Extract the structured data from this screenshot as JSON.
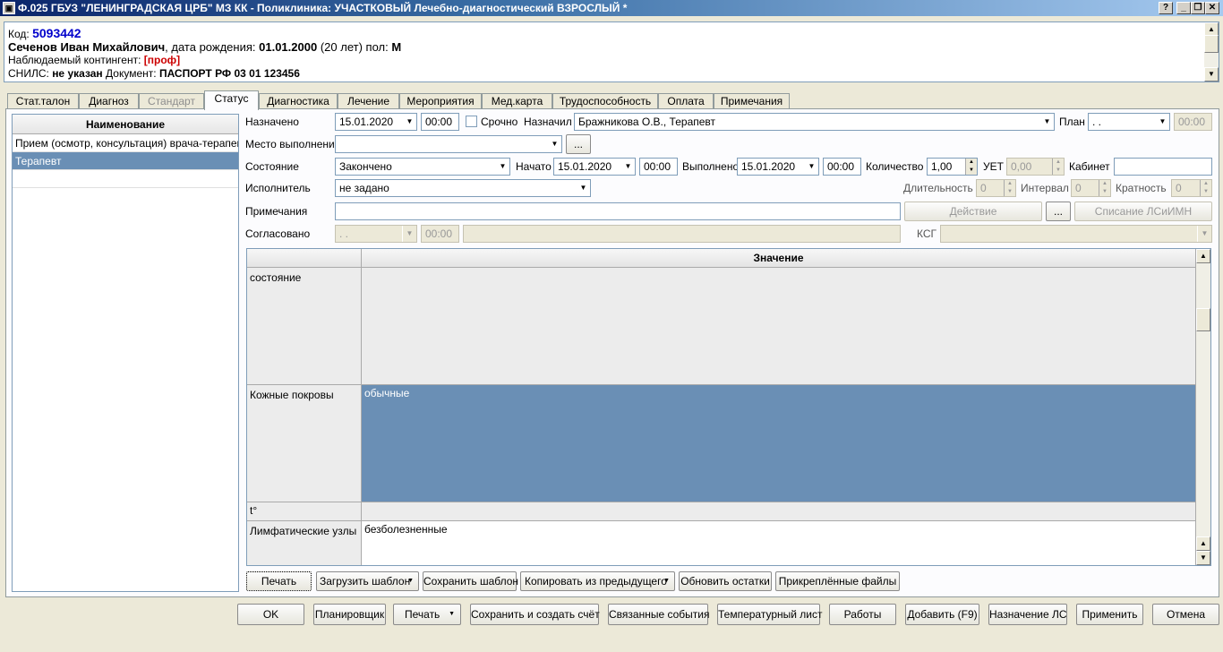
{
  "window": {
    "title": "Ф.025 ГБУЗ \"ЛЕНИНГРАДСКАЯ ЦРБ\" МЗ КК  - Поликлиника: УЧАСТКОВЫЙ Лечебно-диагностический ВЗРОСЛЫЙ *",
    "help_label": "?",
    "min_label": "_",
    "max_label": "❐",
    "close_label": "✕"
  },
  "patient": {
    "code_label": "Код:",
    "code": "5093442",
    "name": "Сеченов Иван Михайлович",
    "dob_label": ", дата рождения:",
    "dob": "01.01.2000",
    "age": "(20 лет)",
    "sex_label": "пол:",
    "sex": "М",
    "contingent_label": "Наблюдаемый контингент:",
    "contingent": "[проф]",
    "snils_label": "СНИЛС:",
    "snils": "не указан",
    "doc_label": "Документ:",
    "doc": "ПАСПОРТ РФ 03 01 123456"
  },
  "tabs": [
    {
      "label": "Стат.талон"
    },
    {
      "label": "Диагноз"
    },
    {
      "label": "Стандарт"
    },
    {
      "label": "Статус"
    },
    {
      "label": "Диагностика"
    },
    {
      "label": "Лечение"
    },
    {
      "label": "Мероприятия"
    },
    {
      "label": "Мед.карта"
    },
    {
      "label": "Трудоспособность"
    },
    {
      "label": "Оплата"
    },
    {
      "label": "Примечания"
    }
  ],
  "left_list": {
    "header": "Наименование",
    "rows": [
      "Прием (осмотр, консультация) врача-терапев...",
      "Терапевт"
    ]
  },
  "form": {
    "assigned_label": "Назначено",
    "assigned_date": "15.01.2020",
    "assigned_time": "00:00",
    "urgent_label": "Срочно",
    "assigned_by_label": "Назначил",
    "assigned_by": "Бражникова О.В., Терапевт",
    "plan_label": "План",
    "plan_value": " .  .",
    "plan_time": "00:00",
    "place_label": "Место выполнения",
    "place_value": "",
    "ellipsis": "...",
    "state_label": "Состояние",
    "state_value": "Закончено",
    "started_label": "Начато",
    "started_date": "15.01.2020",
    "started_time": "00:00",
    "done_label": "Выполнено",
    "done_date": "15.01.2020",
    "done_time": "00:00",
    "qty_label": "Количество",
    "qty_value": "1,00",
    "uet_label": "УЕТ",
    "uet_value": "0,00",
    "cabinet_label": "Кабинет",
    "cabinet_value": "",
    "executor_label": "Исполнитель",
    "executor_value": "не задано",
    "duration_label": "Длительность",
    "duration_value": "0",
    "interval_label": "Интервал",
    "interval_value": "0",
    "multiplicity_label": "Кратность",
    "multiplicity_value": "0",
    "notes_label": "Примечания",
    "notes_value": "",
    "action_button": "Действие",
    "writeoff_button": "Списание ЛСиИМН",
    "agreed_label": "Согласовано",
    "agreed_date": " .  .",
    "agreed_time": "00:00",
    "ksg_label": "КСГ"
  },
  "grid": {
    "value_header": "Значение",
    "rows": [
      {
        "name": "состояние",
        "value": ""
      },
      {
        "name": "Кожные покровы",
        "value": "обычные"
      },
      {
        "name": "t°",
        "value": ""
      },
      {
        "name": "Лимфатические узлы",
        "value": "безболезненные"
      }
    ]
  },
  "inner_buttons": {
    "print": "Печать",
    "load_template": "Загрузить шаблон",
    "save_template": "Сохранить шаблон",
    "copy_prev": "Копировать из предыдущего",
    "refresh_stock": "Обновить остатки",
    "attached_files": "Прикреплённые файлы"
  },
  "bottom_buttons": {
    "ok": "OK",
    "scheduler": "Планировщик",
    "print": "Печать",
    "save_invoice": "Сохранить и создать счёт",
    "linked_events": "Связанные события",
    "temp_sheet": "Температурный лист",
    "works": "Работы",
    "add": "Добавить (F9)",
    "assign_ls": "Назначение ЛС",
    "apply": "Применить",
    "cancel": "Отмена"
  }
}
